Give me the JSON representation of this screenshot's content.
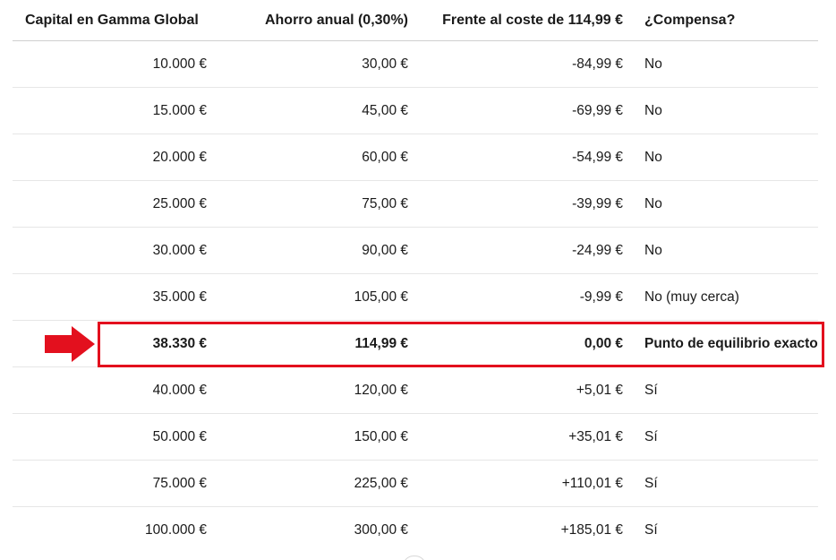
{
  "table": {
    "headers": [
      "Capital en Gamma Global",
      "Ahorro anual (0,30%)",
      "Frente al coste de 114,99 €",
      "¿Compensa?"
    ],
    "rows": [
      [
        "10.000 €",
        "30,00 €",
        "-84,99 €",
        "No"
      ],
      [
        "15.000 €",
        "45,00 €",
        "-69,99 €",
        "No"
      ],
      [
        "20.000 €",
        "60,00 €",
        "-54,99 €",
        "No"
      ],
      [
        "25.000 €",
        "75,00 €",
        "-39,99 €",
        "No"
      ],
      [
        "30.000 €",
        "90,00 €",
        "-24,99 €",
        "No"
      ],
      [
        "35.000 €",
        "105,00 €",
        "-9,99 €",
        "No (muy cerca)"
      ],
      [
        "38.330 €",
        "114,99 €",
        "0,00 €",
        "Punto de equilibrio exacto"
      ],
      [
        "40.000 €",
        "120,00 €",
        "+5,01 €",
        "Sí"
      ],
      [
        "50.000 €",
        "150,00 €",
        "+35,01 €",
        "Sí"
      ],
      [
        "75.000 €",
        "225,00 €",
        "+110,01 €",
        "Sí"
      ],
      [
        "100.000 €",
        "300,00 €",
        "+185,01 €",
        "Sí"
      ]
    ],
    "highlighted_row": 6
  },
  "annotation": {
    "arrow_icon": "arrow-right-icon",
    "color": "#e3101e"
  }
}
